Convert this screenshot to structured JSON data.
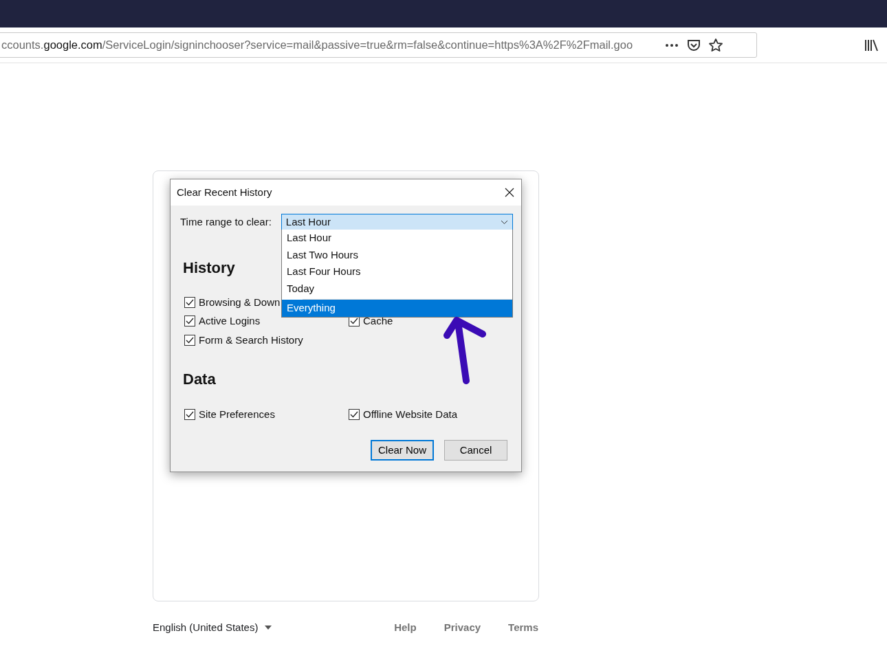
{
  "browser": {
    "url_prefix": "ccounts.",
    "url_domain": "google.com",
    "url_path": "/ServiceLogin/signinchooser?service=mail&passive=true&rm=false&continue=https%3A%2F%2Fmail.goo"
  },
  "dialog": {
    "title": "Clear Recent History",
    "time_range_label": "Time range to clear:",
    "time_range_value": "Last Hour",
    "dropdown_options": [
      {
        "label": "Last Hour",
        "selected": false
      },
      {
        "label": "Last Two Hours",
        "selected": false
      },
      {
        "label": "Last Four Hours",
        "selected": false
      },
      {
        "label": "Today",
        "selected": false
      },
      {
        "label": "Everything",
        "selected": true
      }
    ],
    "sections": [
      {
        "heading": "History",
        "left": [
          {
            "label": "Browsing & Down",
            "checked": true
          },
          {
            "label": "Active Logins",
            "checked": true
          },
          {
            "label": "Form & Search History",
            "checked": true
          }
        ],
        "right": [
          {
            "label": "Cache",
            "checked": true
          }
        ]
      },
      {
        "heading": "Data",
        "left": [
          {
            "label": "Site Preferences",
            "checked": true
          }
        ],
        "right": [
          {
            "label": "Offline Website Data",
            "checked": true
          }
        ]
      }
    ],
    "buttons": [
      {
        "label": "Clear Now",
        "default": true
      },
      {
        "label": "Cancel",
        "default": false
      }
    ]
  },
  "footer": {
    "language": "English (United States)",
    "links": [
      "Help",
      "Privacy",
      "Terms"
    ]
  }
}
